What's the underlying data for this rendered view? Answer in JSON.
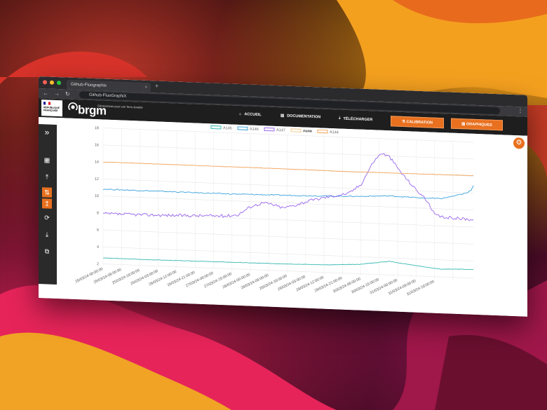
{
  "browser": {
    "tab_title": "Github-Fluographix",
    "tab_close": "×",
    "new_tab": "+",
    "url": "Github-FluoGraphiX"
  },
  "header": {
    "republique": "RÉPUBLIQUE FRANÇAISE",
    "brand": "brgm",
    "tagline": "Géosciences pour une Terre durable",
    "nav": [
      "ACCUEIL",
      "DOCUMENTATION",
      "TÉLÉCHARGER"
    ],
    "btn_calibration": "CALIBRATION",
    "btn_graphiques": "GRAPHIQUES"
  },
  "chart_data": {
    "type": "line",
    "legend": [
      "A145",
      "A146",
      "A147",
      "A148",
      "A144"
    ],
    "series_colors": [
      "#35b8b0",
      "#3aa2dc",
      "#9966ee",
      "#f6c98a",
      "#f2a45a"
    ],
    "hidden_series": [
      "A148"
    ],
    "ylim": [
      2,
      18
    ],
    "yticks": [
      2,
      4,
      6,
      8,
      10,
      12,
      14,
      16,
      18
    ],
    "xticks": [
      "25/03/24-00:00:00",
      "25/03/24-09:00:00",
      "25/03/24-18:00:00",
      "26/03/24-03:00:00",
      "26/03/24-12:00:00",
      "26/03/24-21:00:00",
      "27/03/24-06:00:00",
      "27/03/24-15:00:00",
      "28/03/24-00:00:00",
      "28/03/24-09:00:00",
      "28/03/24-18:00:00",
      "29/03/24-03:00:00",
      "29/03/24-12:00:00",
      "29/03/24-21:00:00",
      "30/03/24-06:00:00",
      "30/03/24-15:00:00",
      "31/03/24-00:00:00",
      "31/03/24-09:00:00",
      "31/03/24-18:00:00"
    ],
    "x_hours": [
      0,
      9,
      18,
      27,
      36,
      45,
      54,
      63,
      72,
      81,
      90,
      99,
      108,
      117,
      126,
      135,
      144,
      153,
      162,
      171
    ],
    "series": [
      {
        "name": "A145",
        "x": [
          0,
          20,
          50,
          80,
          110,
          125,
          140,
          150,
          165,
          175,
          181
        ],
        "y": [
          2.7,
          2.7,
          2.75,
          2.8,
          2.9,
          3.1,
          3.6,
          3.3,
          2.9,
          3.0,
          3.0
        ]
      },
      {
        "name": "A146",
        "x": [
          0,
          30,
          60,
          90,
          110,
          125,
          140,
          155,
          165,
          172,
          178,
          180,
          181
        ],
        "y": [
          10.8,
          10.8,
          10.8,
          10.9,
          11.0,
          11.1,
          11.3,
          11.2,
          11.2,
          11.6,
          12.0,
          12.4,
          12.9
        ]
      },
      {
        "name": "A147",
        "x": [
          0,
          30,
          60,
          66,
          72,
          78,
          82,
          88,
          94,
          100,
          108,
          114,
          120,
          126,
          132,
          136,
          140,
          146,
          152,
          158,
          162,
          166,
          170,
          181
        ],
        "y": [
          7.9,
          8.0,
          8.2,
          8.4,
          9.4,
          9.9,
          9.8,
          9.4,
          9.8,
          10.3,
          10.8,
          11.1,
          11.4,
          12.5,
          15.2,
          16.3,
          15.9,
          14.0,
          12.4,
          11.0,
          9.3,
          9.0,
          9.0,
          8.9
        ]
      },
      {
        "name": "A148",
        "x": [],
        "y": []
      },
      {
        "name": "A144",
        "x": [
          0,
          100,
          120,
          130,
          181
        ],
        "y": [
          14.0,
          14.0,
          13.95,
          14.0,
          14.05
        ]
      }
    ]
  },
  "icons": {
    "expand": "»",
    "gear": "⚙"
  }
}
